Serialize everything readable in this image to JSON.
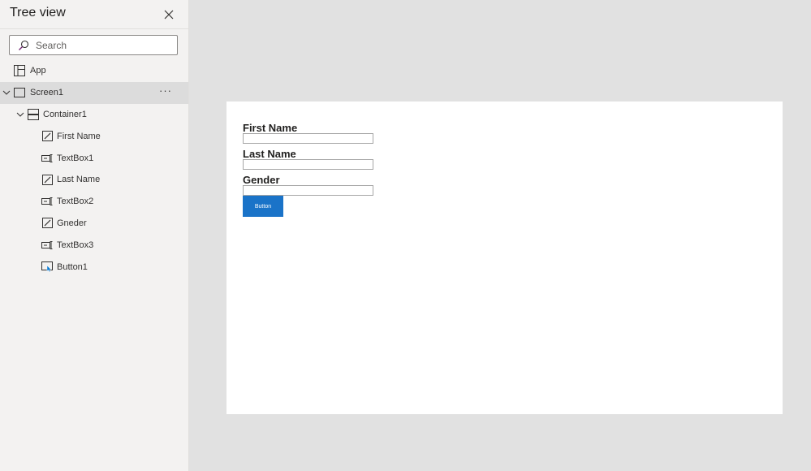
{
  "panel": {
    "title": "Tree view",
    "search_placeholder": "Search"
  },
  "tree": {
    "app": "App",
    "screen": "Screen1",
    "more": "···",
    "container": "Container1",
    "items": [
      {
        "label": "First Name",
        "icon": "label-edit-icon"
      },
      {
        "label": "TextBox1",
        "icon": "textbox-icon"
      },
      {
        "label": "Last Name",
        "icon": "label-edit-icon"
      },
      {
        "label": "TextBox2",
        "icon": "textbox-icon"
      },
      {
        "label": "Gneder",
        "icon": "label-edit-icon"
      },
      {
        "label": "TextBox3",
        "icon": "textbox-icon"
      },
      {
        "label": "Button1",
        "icon": "button-icon"
      }
    ]
  },
  "form": {
    "first_name_label": "First Name",
    "last_name_label": "Last Name",
    "gender_label": "Gender",
    "button_label": "Button"
  },
  "colors": {
    "accent": "#1a73c8",
    "panel_bg": "#f3f2f1",
    "workspace_bg": "#e1e1e1",
    "selected_row": "#dcdcdc"
  }
}
